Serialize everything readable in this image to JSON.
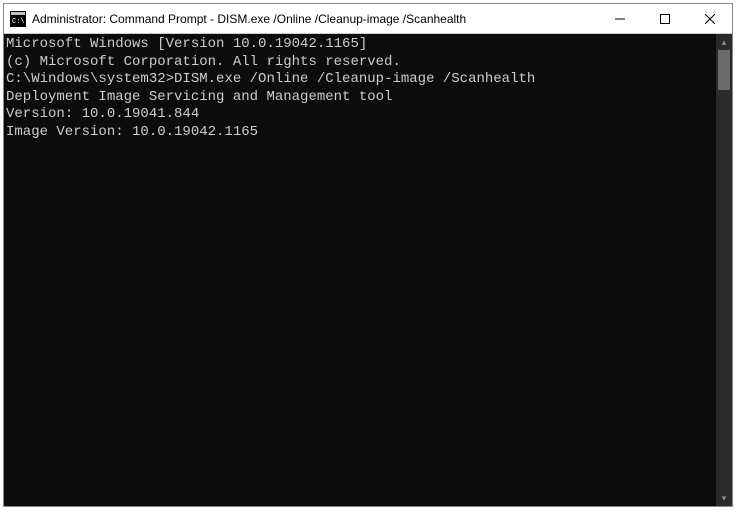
{
  "titlebar": {
    "title": "Administrator: Command Prompt - DISM.exe  /Online /Cleanup-image /Scanhealth"
  },
  "console": {
    "line1": "Microsoft Windows [Version 10.0.19042.1165]",
    "line2": "(c) Microsoft Corporation. All rights reserved.",
    "blank1": "",
    "prompt_path": "C:\\Windows\\system32>",
    "command": "DISM.exe /Online /Cleanup-image /Scanhealth",
    "blank2": "",
    "tool_line1": "Deployment Image Servicing and Management tool",
    "tool_line2": "Version: 10.0.19041.844",
    "blank3": "",
    "image_version": "Image Version: 10.0.19042.1165"
  }
}
